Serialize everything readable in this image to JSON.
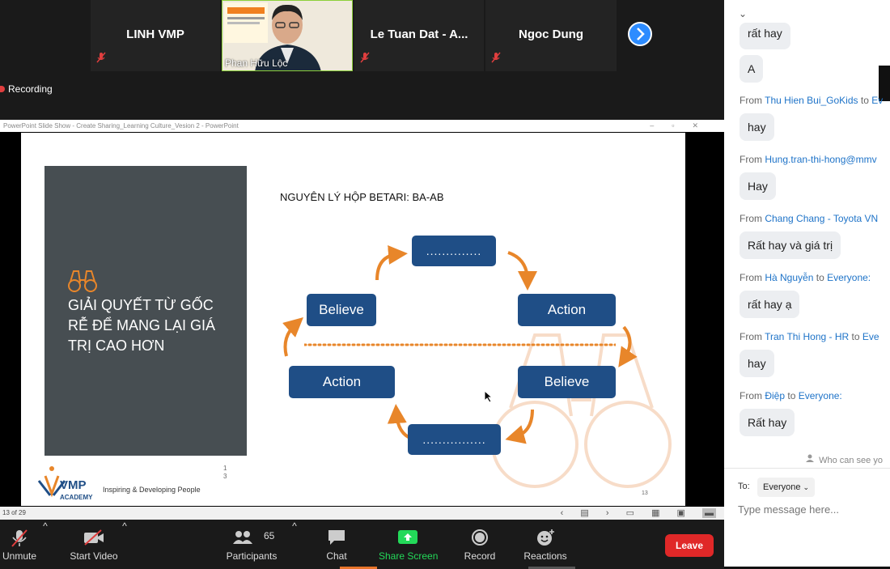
{
  "participants": {
    "tiles": [
      {
        "name": "LINH VMP",
        "muted": true
      },
      {
        "name": "Phan Hữu Lộc",
        "video": true
      },
      {
        "name": "Le Tuan Dat - A...",
        "muted": true
      },
      {
        "name": "Ngoc Dung",
        "muted": true
      }
    ]
  },
  "recording_label": "Recording",
  "ppt": {
    "title": "PowerPoint Slide Show  -  Create Sharing_Learning Culture_Vesion 2  -  PowerPoint",
    "status": "13 of 29",
    "slide": {
      "panel_text": "GIẢI QUYẾT TỪ GỐC RỄ ĐỂ MANG LẠI GIÁ TRỊ CAO HƠN",
      "heading": "NGUYÊN LÝ HỘP BETARI: BA-AB",
      "boxes": {
        "top": "..............",
        "believe_left": "Believe",
        "action_right": "Action",
        "action_left": "Action",
        "believe_right": "Believe",
        "bottom": "................"
      },
      "page_small_1": "1",
      "page_small_2": "3",
      "page_num": "13",
      "logo_text": "VMP",
      "logo_sub": "ACADEMY",
      "tagline": "Inspiring & Developing People"
    }
  },
  "toolbar": {
    "unmute": "Unmute",
    "start_video": "Start Video",
    "participants": "Participants",
    "participants_count": "65",
    "chat": "Chat",
    "share_screen": "Share Screen",
    "record": "Record",
    "reactions": "Reactions",
    "leave": "Leave"
  },
  "chat": {
    "messages": [
      {
        "from": "",
        "to": "",
        "text": "rất hay"
      },
      {
        "from": "",
        "to": "",
        "text": "A"
      },
      {
        "from": "Thu Hien Bui_GoKids",
        "to": "Ev",
        "text": "hay"
      },
      {
        "from": "Hung.tran-thi-hong@mmv",
        "to": "",
        "text": "Hay"
      },
      {
        "from": "Chang Chang - Toyota VN",
        "to": "",
        "text": "Rất hay và giá trị"
      },
      {
        "from": "Hà Nguyễn",
        "to": "Everyone:",
        "text": "rất hay ạ"
      },
      {
        "from": "Tran Thi Hong - HR",
        "to": "Eve",
        "text": "hay"
      },
      {
        "from": "Điệp",
        "to": "Everyone:",
        "text": "Rất hay"
      }
    ],
    "from_word": "From",
    "to_word": "to",
    "who_can_see": "Who can see yo",
    "to_label": "To:",
    "recipient": "Everyone",
    "placeholder": "Type message here..."
  }
}
